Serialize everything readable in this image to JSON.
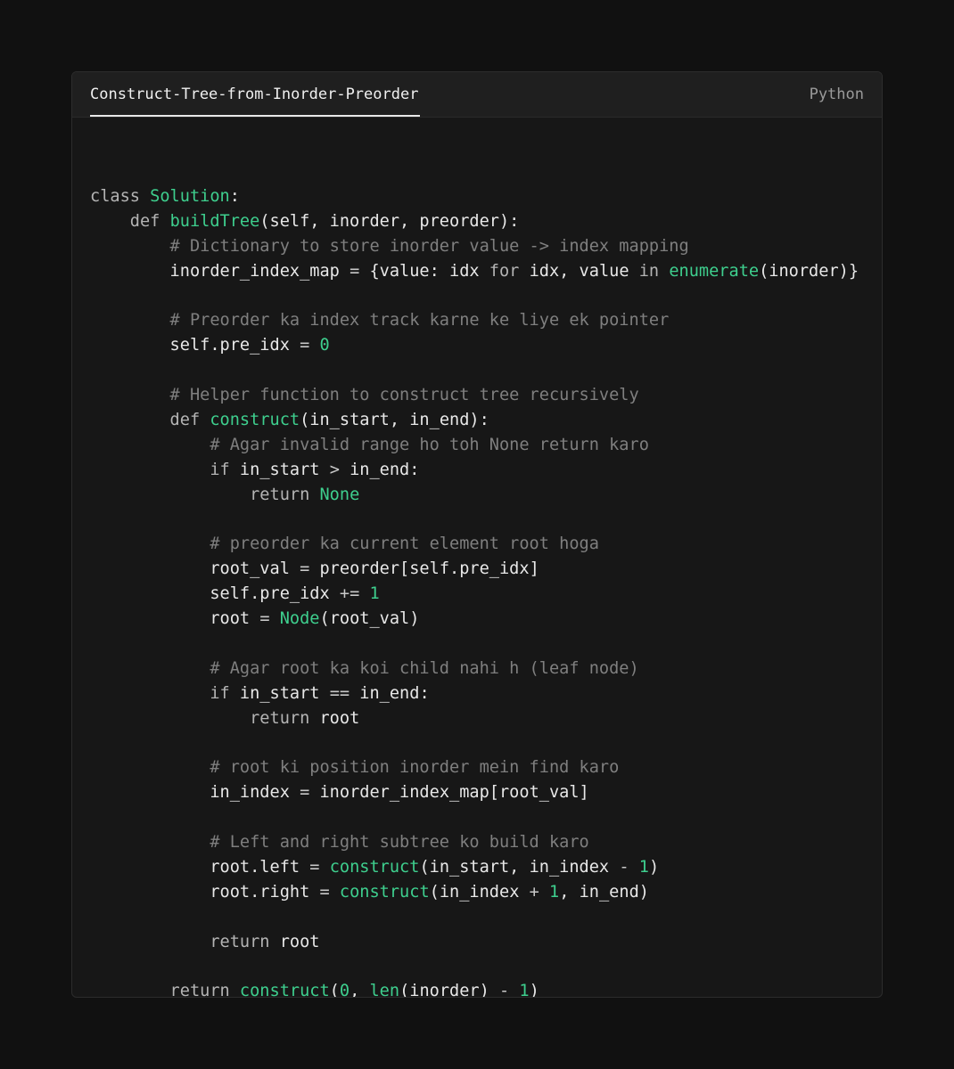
{
  "window": {
    "tab_title": "Construct-Tree-from-Inorder-Preorder",
    "language": "Python"
  },
  "colors": {
    "background": "#111111",
    "card": "#171717",
    "header": "#1f1f1f",
    "accent_green": "#3ecf8e",
    "comment_gray": "#7f7f7f",
    "keyword_gray": "#b4b4b4",
    "text": "#f2f2f2"
  },
  "code": {
    "lines": [
      [],
      [
        {
          "t": "class ",
          "c": "k"
        },
        {
          "t": "Solution",
          "c": "fn"
        },
        {
          "t": ":",
          "c": "p"
        }
      ],
      [
        {
          "t": "    def ",
          "c": "k"
        },
        {
          "t": "buildTree",
          "c": "fn"
        },
        {
          "t": "(self, inorder, preorder):",
          "c": "p"
        }
      ],
      [
        {
          "t": "        # Dictionary to store inorder value -> index mapping",
          "c": "c"
        }
      ],
      [
        {
          "t": "        inorder_index_map ",
          "c": "p"
        },
        {
          "t": "=",
          "c": "op"
        },
        {
          "t": " {value: idx ",
          "c": "p"
        },
        {
          "t": "for",
          "c": "k"
        },
        {
          "t": " idx, value ",
          "c": "p"
        },
        {
          "t": "in",
          "c": "k"
        },
        {
          "t": " ",
          "c": "p"
        },
        {
          "t": "enumerate",
          "c": "fn"
        },
        {
          "t": "(inorder)}",
          "c": "p"
        }
      ],
      [],
      [
        {
          "t": "        # Preorder ka index track karne ke liye ek pointer",
          "c": "c"
        }
      ],
      [
        {
          "t": "        self.pre_idx ",
          "c": "p"
        },
        {
          "t": "=",
          "c": "op"
        },
        {
          "t": " ",
          "c": "p"
        },
        {
          "t": "0",
          "c": "num"
        }
      ],
      [],
      [
        {
          "t": "        # Helper function to construct tree recursively",
          "c": "c"
        }
      ],
      [
        {
          "t": "        def ",
          "c": "k"
        },
        {
          "t": "construct",
          "c": "fn"
        },
        {
          "t": "(in_start, in_end):",
          "c": "p"
        }
      ],
      [
        {
          "t": "            # Agar invalid range ho toh None return karo",
          "c": "c"
        }
      ],
      [
        {
          "t": "            if",
          "c": "k"
        },
        {
          "t": " in_start ",
          "c": "p"
        },
        {
          "t": ">",
          "c": "op"
        },
        {
          "t": " in_end:",
          "c": "p"
        }
      ],
      [
        {
          "t": "                return ",
          "c": "k"
        },
        {
          "t": "None",
          "c": "fn"
        }
      ],
      [],
      [
        {
          "t": "            # preorder ka current element root hoga",
          "c": "c"
        }
      ],
      [
        {
          "t": "            root_val ",
          "c": "p"
        },
        {
          "t": "=",
          "c": "op"
        },
        {
          "t": " preorder[self.pre_idx]",
          "c": "p"
        }
      ],
      [
        {
          "t": "            self.pre_idx ",
          "c": "p"
        },
        {
          "t": "+=",
          "c": "op"
        },
        {
          "t": " ",
          "c": "p"
        },
        {
          "t": "1",
          "c": "num"
        }
      ],
      [
        {
          "t": "            root ",
          "c": "p"
        },
        {
          "t": "=",
          "c": "op"
        },
        {
          "t": " ",
          "c": "p"
        },
        {
          "t": "Node",
          "c": "fn"
        },
        {
          "t": "(root_val)",
          "c": "p"
        }
      ],
      [],
      [
        {
          "t": "            # Agar root ka koi child nahi h (leaf node)",
          "c": "c"
        }
      ],
      [
        {
          "t": "            if",
          "c": "k"
        },
        {
          "t": " in_start ",
          "c": "p"
        },
        {
          "t": "==",
          "c": "op"
        },
        {
          "t": " in_end:",
          "c": "p"
        }
      ],
      [
        {
          "t": "                return ",
          "c": "k"
        },
        {
          "t": "root",
          "c": "p"
        }
      ],
      [],
      [
        {
          "t": "            # root ki position inorder mein find karo",
          "c": "c"
        }
      ],
      [
        {
          "t": "            in_index ",
          "c": "p"
        },
        {
          "t": "=",
          "c": "op"
        },
        {
          "t": " inorder_index_map[root_val]",
          "c": "p"
        }
      ],
      [],
      [
        {
          "t": "            # Left and right subtree ko build karo",
          "c": "c"
        }
      ],
      [
        {
          "t": "            root.left ",
          "c": "p"
        },
        {
          "t": "=",
          "c": "op"
        },
        {
          "t": " ",
          "c": "p"
        },
        {
          "t": "construct",
          "c": "fn"
        },
        {
          "t": "(in_start, in_index ",
          "c": "p"
        },
        {
          "t": "-",
          "c": "op"
        },
        {
          "t": " ",
          "c": "p"
        },
        {
          "t": "1",
          "c": "num"
        },
        {
          "t": ")",
          "c": "p"
        }
      ],
      [
        {
          "t": "            root.right ",
          "c": "p"
        },
        {
          "t": "=",
          "c": "op"
        },
        {
          "t": " ",
          "c": "p"
        },
        {
          "t": "construct",
          "c": "fn"
        },
        {
          "t": "(in_index ",
          "c": "p"
        },
        {
          "t": "+",
          "c": "op"
        },
        {
          "t": " ",
          "c": "p"
        },
        {
          "t": "1",
          "c": "num"
        },
        {
          "t": ", in_end)",
          "c": "p"
        }
      ],
      [],
      [
        {
          "t": "            return ",
          "c": "k"
        },
        {
          "t": "root",
          "c": "p"
        }
      ],
      [],
      [
        {
          "t": "        return ",
          "c": "k"
        },
        {
          "t": "construct",
          "c": "fn"
        },
        {
          "t": "(",
          "c": "p"
        },
        {
          "t": "0",
          "c": "num"
        },
        {
          "t": ", ",
          "c": "p"
        },
        {
          "t": "len",
          "c": "fn"
        },
        {
          "t": "(inorder) ",
          "c": "p"
        },
        {
          "t": "-",
          "c": "op"
        },
        {
          "t": " ",
          "c": "p"
        },
        {
          "t": "1",
          "c": "num"
        },
        {
          "t": ")",
          "c": "p"
        }
      ]
    ]
  }
}
